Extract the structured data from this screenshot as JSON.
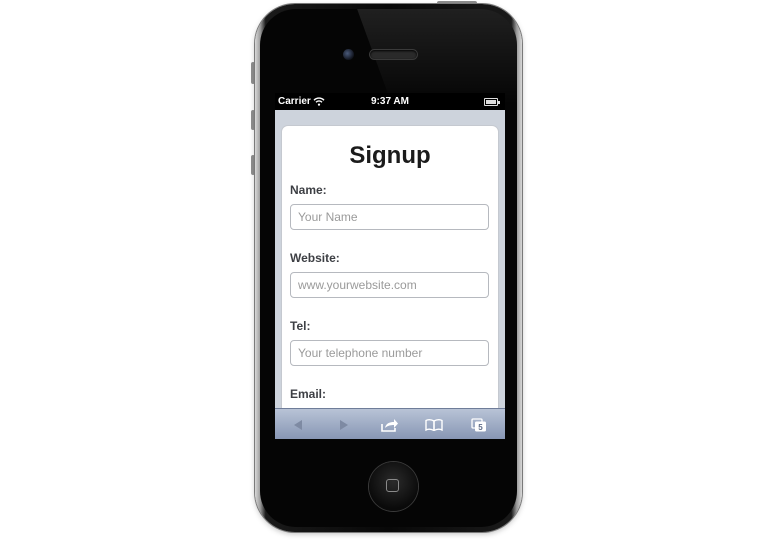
{
  "status_bar": {
    "carrier": "Carrier",
    "time": "9:37 AM"
  },
  "form": {
    "title": "Signup",
    "fields": [
      {
        "label": "Name:",
        "placeholder": "Your Name",
        "value": ""
      },
      {
        "label": "Website:",
        "placeholder": "www.yourwebsite.com",
        "value": ""
      },
      {
        "label": "Tel:",
        "placeholder": "Your telephone number",
        "value": ""
      },
      {
        "label": "Email:",
        "placeholder": "",
        "value": ""
      }
    ]
  },
  "toolbar": {
    "back_icon": "back-arrow-icon",
    "forward_icon": "forward-arrow-icon",
    "share_icon": "share-icon",
    "bookmarks_icon": "bookmarks-icon",
    "tabs_icon": "tabs-icon",
    "tabs_count": "5"
  },
  "colors": {
    "toolbar_top": "#b8c3d6",
    "toolbar_bottom": "#8695b3",
    "label_text": "#3d3f44"
  }
}
